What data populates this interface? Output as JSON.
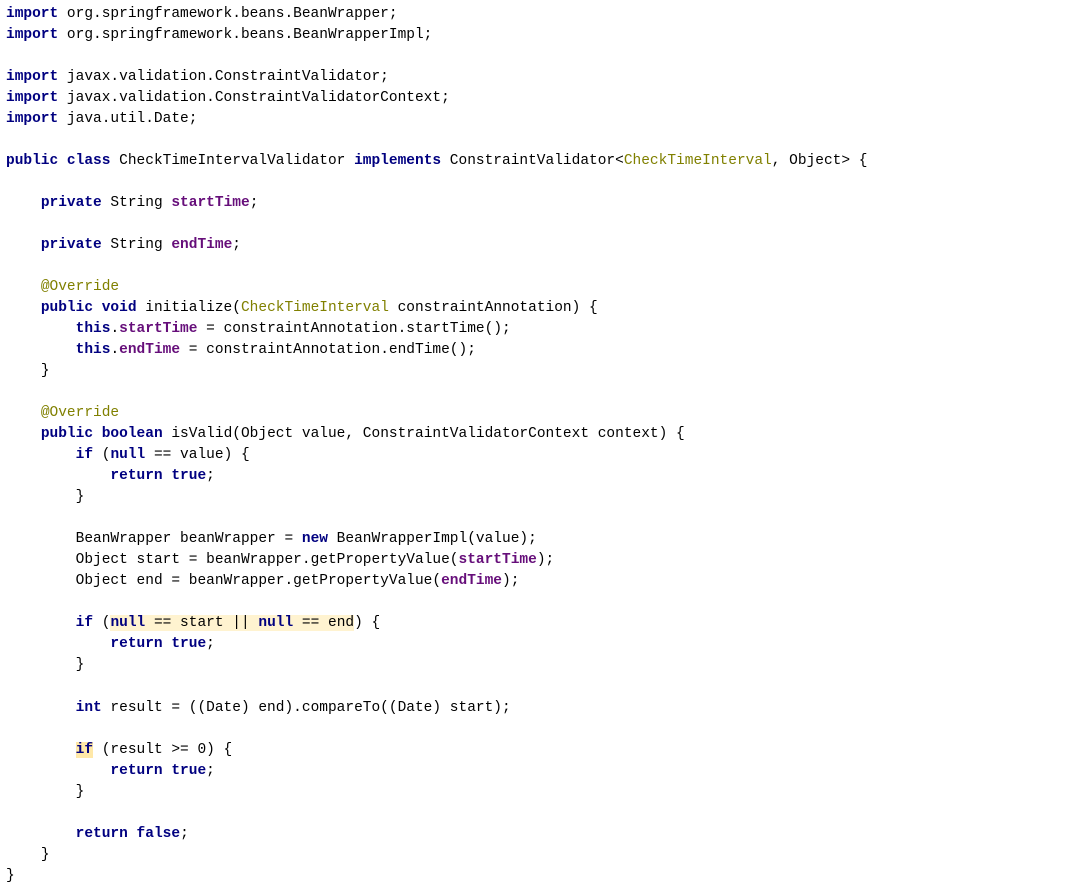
{
  "kw": {
    "import": "import",
    "public": "public",
    "class": "class",
    "implements": "implements",
    "private": "private",
    "void": "void",
    "this": "this",
    "boolean": "boolean",
    "if": "if",
    "null": "null",
    "return": "return",
    "true": "true",
    "false": "false",
    "new": "new",
    "int": "int"
  },
  "imports": {
    "i1": " org.springframework.beans.BeanWrapper;",
    "i2": " org.springframework.beans.BeanWrapperImpl;",
    "i3": " javax.validation.ConstraintValidator;",
    "i4": " javax.validation.ConstraintValidatorContext;",
    "i5": " java.util.Date;"
  },
  "cls": {
    "decl_mid": " CheckTimeIntervalValidator ",
    "decl_after_impl": " ConstraintValidator<",
    "generic": "CheckTimeInterval",
    "decl_tail": ", Object> {"
  },
  "fields": {
    "stringType": " String ",
    "startName": "startTime",
    "endName": "endTime",
    "semi": ";"
  },
  "override": "@Override",
  "init": {
    "sig_a": " initialize(",
    "sig_b": " constraintAnnotation) {",
    "assign_start_a": ".",
    "assign_start_b": " = constraintAnnotation.startTime();",
    "assign_end_b": " = constraintAnnotation.endTime();"
  },
  "valid": {
    "sig": " isValid(Object value, ConstraintValidatorContext context) {",
    "nullchk_open": " (",
    "nullchk_eq": " == value) {",
    "semi": ";",
    "close": "}",
    "bw_line": "BeanWrapper beanWrapper = ",
    "bw_ctor": " BeanWrapperImpl(value);",
    "start_line_a": "Object start = beanWrapper.getPropertyValue(",
    "start_line_b": ");",
    "end_line_a": "Object end = beanWrapper.getPropertyValue(",
    "end_line_b": ");",
    "cond_open": " (",
    "cond_eq1": " == start",
    "cond_or": " || ",
    "cond_eq2": " == end",
    "cond_close": ") {",
    "result_line": " result = ((Date) end).compareTo((Date) start);",
    "resif_open": " (result >= 0) {"
  }
}
